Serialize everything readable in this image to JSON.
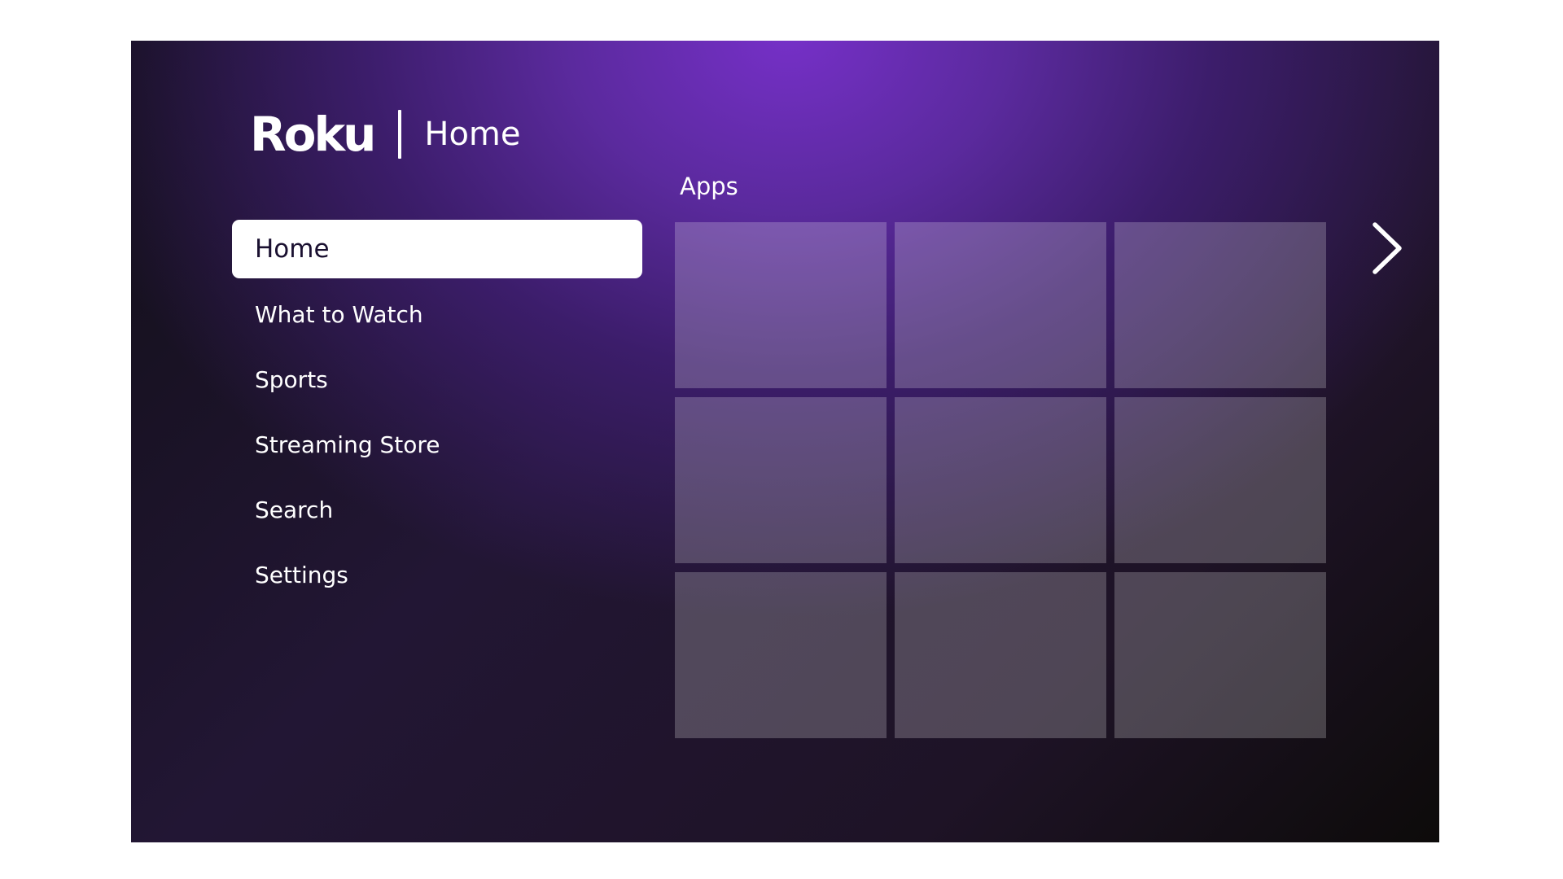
{
  "header": {
    "logo": "Roku",
    "title": "Home"
  },
  "nav": {
    "items": [
      {
        "label": "Home",
        "active": true
      },
      {
        "label": "What to Watch"
      },
      {
        "label": "Sports"
      },
      {
        "label": "Streaming Store"
      },
      {
        "label": "Search"
      },
      {
        "label": "Settings"
      }
    ]
  },
  "apps": {
    "section_label": "Apps",
    "tile_count": 9
  },
  "icons": {
    "next": "chevron-right-icon"
  },
  "colors": {
    "accent_purple": "#7630c8",
    "active_item_bg": "#ffffff",
    "text": "#ffffff"
  }
}
